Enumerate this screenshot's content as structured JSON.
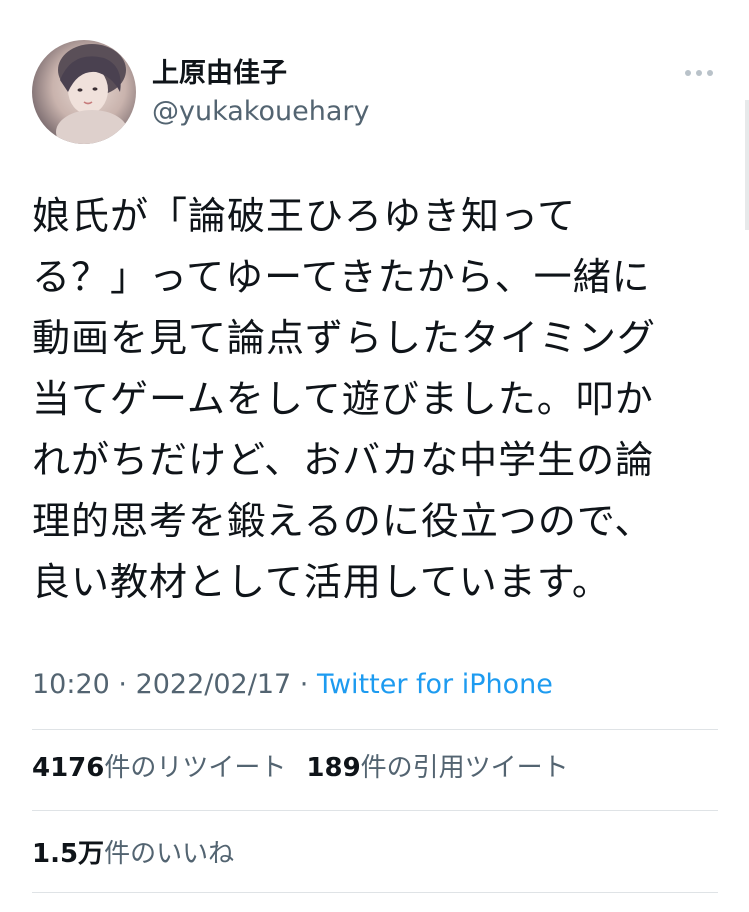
{
  "author": {
    "display_name": "上原由佳子",
    "handle": "@yukakouehary",
    "avatar_icon": "user-avatar-photo"
  },
  "more_icon": "more-options-icon",
  "tweet": {
    "lines": [
      "娘氏が「論破王ひろゆき知って",
      "る？」ってゆーてきたから、一緒に",
      "動画を見て論点ずらしたタイミング",
      "当てゲームをして遊びました。叩か",
      "れがちだけど、おバカな中学生の論",
      "理的思考を鍛えるのに役立つので、",
      "良い教材として活用しています。"
    ]
  },
  "meta": {
    "time": "10:20",
    "separator1": " · ",
    "date": "2022/02/17",
    "separator2": " · ",
    "source": "Twitter for iPhone"
  },
  "stats": {
    "retweets_count": "4176",
    "retweets_label": "件のリツイート",
    "quotes_count": "189",
    "quotes_label": "件の引用ツイート",
    "likes_count": "1.5万",
    "likes_label": "件のいいね"
  },
  "colors": {
    "text": "#0f1419",
    "secondary": "#536471",
    "link": "#1d9bf0",
    "divider": "#dfe3e6"
  }
}
